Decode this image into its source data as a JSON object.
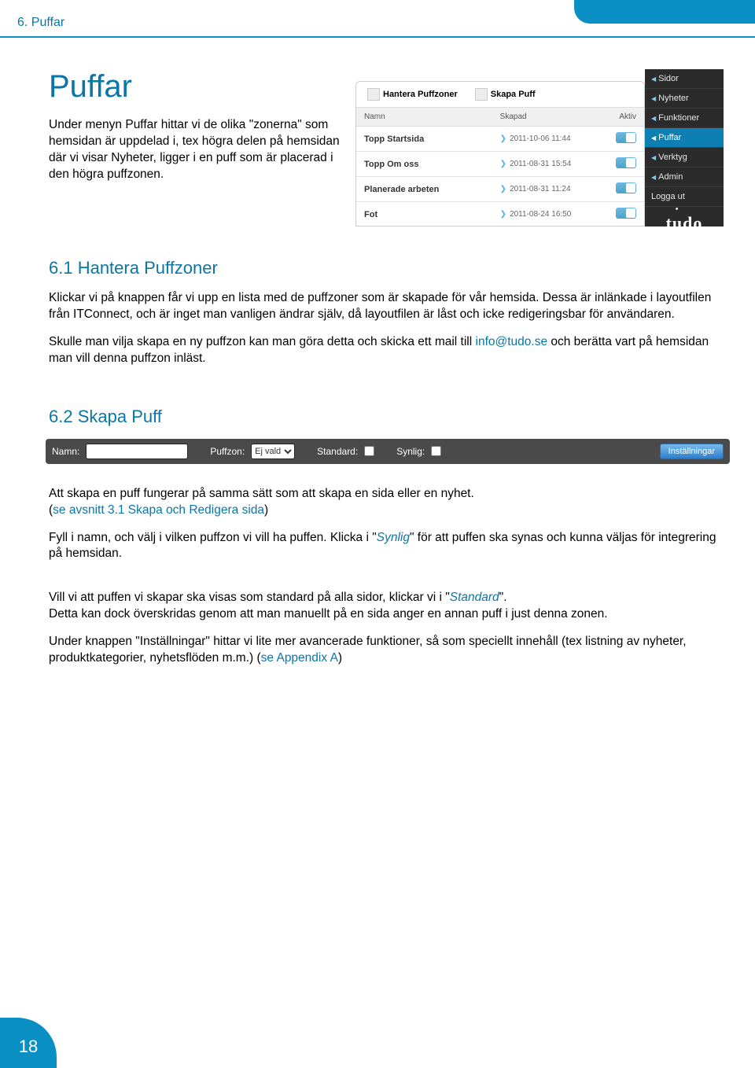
{
  "meta": {
    "page_number": "18"
  },
  "header": {
    "crumb": "6. Puffar",
    "title": "Puffar"
  },
  "intro": {
    "text": "Under menyn Puffar hittar vi de olika \"zonerna\" som hemsidan är uppdelad i, tex högra delen på hemsidan där vi visar Nyheter, ligger i en puff som är placerad i den högra puffzonen."
  },
  "screenshot1": {
    "tabs": {
      "manage": "Hantera Puffzoner",
      "create": "Skapa Puff"
    },
    "columns": {
      "name": "Namn",
      "created": "Skapad",
      "active": "Aktiv"
    },
    "rows": [
      {
        "name": "Topp Startsida",
        "created": "2011-10-06 11:44"
      },
      {
        "name": "Topp Om oss",
        "created": "2011-08-31 15:54"
      },
      {
        "name": "Planerade arbeten",
        "created": "2011-08-31 11:24"
      },
      {
        "name": "Fot",
        "created": "2011-08-24 16:50"
      }
    ],
    "sidemenu": {
      "items": [
        "Sidor",
        "Nyheter",
        "Funktioner",
        "Puffar",
        "Verktyg",
        "Admin",
        "Logga ut"
      ],
      "active_index": 3,
      "logo": "tudo"
    }
  },
  "sections": {
    "s61": {
      "heading": "6.1 Hantera Puffzoner",
      "p1": "Klickar vi på knappen får vi upp en lista med de puffzoner som är skapade för vår hemsida. Dessa är inlänkade i layoutfilen från ITConnect, och är inget man vanligen ändrar själv, då layoutfilen är låst och icke redigeringsbar för användaren.",
      "p2a": "Skulle man vilja skapa en ny puffzon kan man göra detta och skicka ett mail till ",
      "p2_link": "info@tudo.se",
      "p2b": " och berätta vart på hemsidan man vill denna puffzon inläst."
    },
    "s62": {
      "heading": "6.2 Skapa Puff",
      "bar": {
        "namn_label": "Namn:",
        "puffzon_label": "Puffzon:",
        "puffzon_value": "Ej vald",
        "standard_label": "Standard:",
        "synlig_label": "Synlig:",
        "settings_btn": "Inställningar"
      },
      "p1": "Att skapa en puff fungerar på samma sätt som att skapa en sida eller en nyhet.",
      "p1_link_pre": "(",
      "p1_link": "se avsnitt 3.1 Skapa och Redigera sida",
      "p1_link_post": ")",
      "p2a": "Fyll i namn, och välj i vilken puffzon vi vill ha puffen. Klicka i \"",
      "p2_em": "Synlig",
      "p2b": "\" för att puffen ska synas och kunna väljas för integrering på hemsidan.",
      "p3a": "Vill vi att puffen vi skapar ska visas som standard på alla sidor, klickar vi i \"",
      "p3_em": "Standard",
      "p3b": "\".\nDetta kan dock överskridas genom att man manuellt på en sida anger en annan puff i just denna zonen.",
      "p4a": "Under knappen \"Inställningar\" hittar vi lite mer avancerade funktioner, så som speciellt innehåll (tex listning av nyheter, produktkategorier, nyhetsflöden m.m.) (",
      "p4_link": "se Appendix A",
      "p4b": ")"
    }
  }
}
